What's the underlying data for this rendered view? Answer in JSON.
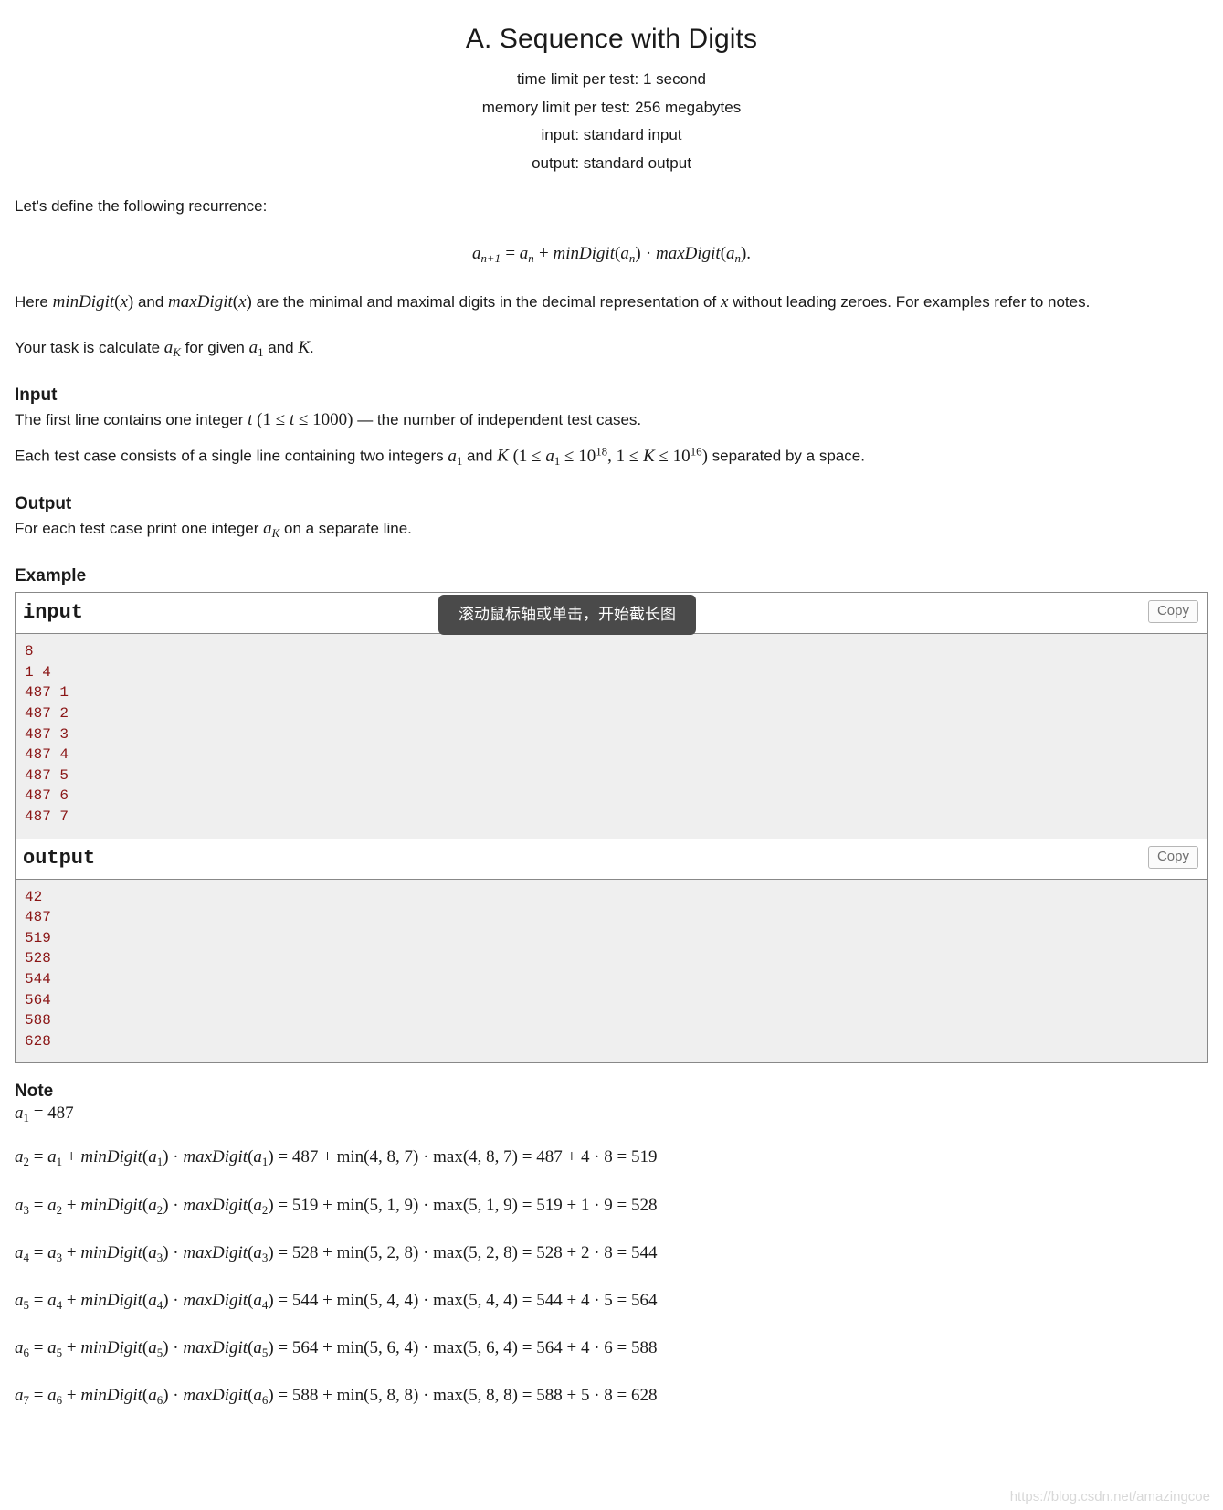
{
  "problem": {
    "title": "A. Sequence with Digits",
    "limits": [
      "time limit per test: 1 second",
      "memory limit per test: 256 megabytes",
      "input: standard input",
      "output: standard output"
    ]
  },
  "statement": {
    "intro": "Let's define the following recurrence:",
    "formula": "a_{n+1} = a_n + minDigit(a_n) · maxDigit(a_n).",
    "here_1": "Here ",
    "min_fn": "minDigit",
    "and_1": " and ",
    "max_fn": "maxDigit",
    "here_2": " are the minimal and maximal digits in the decimal representation of ",
    "var_x": "x",
    "here_3": " without leading zeroes. For examples refer to notes.",
    "task_1": "Your task is calculate ",
    "task_ak": "a_K",
    "task_2": " for given ",
    "task_a1": "a_1",
    "task_3": " and ",
    "task_K": "K",
    "task_4": "."
  },
  "input_section": {
    "heading": "Input",
    "line1_a": "The first line contains one integer ",
    "line1_t": "t",
    "line1_b": " (1 ≤ t ≤ 1000) — the number of independent test cases.",
    "line1_paren_open": "(",
    "line1_cons": "1 ≤ t ≤ 1000",
    "line1_paren_close": ")",
    "line1_tail": " — the number of independent test cases.",
    "line2_a": "Each test case consists of a single line containing two integers ",
    "line2_a1": "a_1",
    "line2_and": " and ",
    "line2_K": "K",
    "line2_cons_open": " (",
    "line2_c1": "1 ≤ a_1 ≤ 10^18",
    "line2_comma": ", ",
    "line2_c2": "1 ≤ K ≤ 10^16",
    "line2_cons_close": ")",
    "line2_tail": " separated by a space.",
    "exp_18": "18",
    "exp_16": "16"
  },
  "output_section": {
    "heading": "Output",
    "text_a": "For each test case print one integer ",
    "text_ak": "a_K",
    "text_b": " on a separate line."
  },
  "example_section": {
    "heading": "Example",
    "input_label": "input",
    "output_label": "output",
    "copy_label": "Copy",
    "input_lines": [
      "8",
      "1 4",
      "487 1",
      "487 2",
      "487 3",
      "487 4",
      "487 5",
      "487 6",
      "487 7"
    ],
    "output_lines": [
      "42",
      "487",
      "519",
      "528",
      "544",
      "564",
      "588",
      "628"
    ]
  },
  "note_section": {
    "heading": "Note",
    "a1": "a_1 = 487",
    "lines": [
      {
        "lhs": "a_2",
        "rec": "a_1 + minDigit(a_1) · maxDigit(a_1)",
        "val": "487",
        "min": "min(4, 8, 7)",
        "max": "max(4, 8, 7)",
        "sum": "487 + 4 · 8",
        "result": "519",
        "idx": "2",
        "pidx": "1",
        "d1": "4",
        "d2": "8",
        "d3": "7",
        "mind": "4",
        "maxd": "8"
      },
      {
        "lhs": "a_3",
        "rec": "a_2 + minDigit(a_2) · maxDigit(a_2)",
        "val": "519",
        "min": "min(5, 1, 9)",
        "max": "max(5, 1, 9)",
        "sum": "519 + 1 · 9",
        "result": "528",
        "idx": "3",
        "pidx": "2",
        "d1": "5",
        "d2": "1",
        "d3": "9",
        "mind": "1",
        "maxd": "9"
      },
      {
        "lhs": "a_4",
        "rec": "a_3 + minDigit(a_3) · maxDigit(a_3)",
        "val": "528",
        "min": "min(5, 2, 8)",
        "max": "max(5, 2, 8)",
        "sum": "528 + 2 · 8",
        "result": "544",
        "idx": "4",
        "pidx": "3",
        "d1": "5",
        "d2": "2",
        "d3": "8",
        "mind": "2",
        "maxd": "8"
      },
      {
        "lhs": "a_5",
        "rec": "a_4 + minDigit(a_4) · maxDigit(a_4)",
        "val": "544",
        "min": "min(5, 4, 4)",
        "max": "max(5, 4, 4)",
        "sum": "544 + 4 · 5",
        "result": "564",
        "idx": "5",
        "pidx": "4",
        "d1": "5",
        "d2": "4",
        "d3": "4",
        "mind": "4",
        "maxd": "5"
      },
      {
        "lhs": "a_6",
        "rec": "a_5 + minDigit(a_5) · maxDigit(a_5)",
        "val": "564",
        "min": "min(5, 6, 4)",
        "max": "max(5, 6, 4)",
        "sum": "564 + 4 · 6",
        "result": "588",
        "idx": "6",
        "pidx": "5",
        "d1": "5",
        "d2": "6",
        "d3": "4",
        "mind": "4",
        "maxd": "6"
      },
      {
        "lhs": "a_7",
        "rec": "a_6 + minDigit(a_6) · maxDigit(a_6)",
        "val": "588",
        "min": "min(5, 8, 8)",
        "max": "max(5, 8, 8)",
        "sum": "588 + 5 · 8",
        "result": "628",
        "idx": "7",
        "pidx": "6",
        "d1": "5",
        "d2": "8",
        "d3": "8",
        "mind": "5",
        "maxd": "8"
      }
    ]
  },
  "overlay": {
    "tooltip_text": "滚动鼠标轴或单击，开始截长图"
  },
  "watermark": {
    "text": "https://blog.csdn.net/amazingcoe"
  },
  "colors": {
    "sample_text": "#8a1515",
    "sample_bg": "#efefef",
    "tooltip_bg": "#4a4a4a",
    "border": "#888888"
  }
}
